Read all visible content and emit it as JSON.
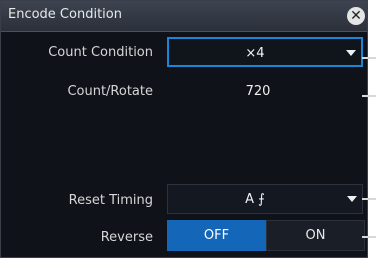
{
  "dialog": {
    "title": "Encode Condition",
    "close_glyph": "✕"
  },
  "count_condition": {
    "label": "Count Condition",
    "value": "×4"
  },
  "count_rotate": {
    "label": "Count/Rotate",
    "value": "720"
  },
  "reset_timing": {
    "label": "Reset Timing",
    "value": "A ⨍"
  },
  "reverse": {
    "label": "Reverse",
    "options": [
      "OFF",
      "ON"
    ],
    "selected": "OFF"
  },
  "colors": {
    "accent": "#1466b8",
    "focus_border": "#1b86d8",
    "background": "#0f1219"
  }
}
